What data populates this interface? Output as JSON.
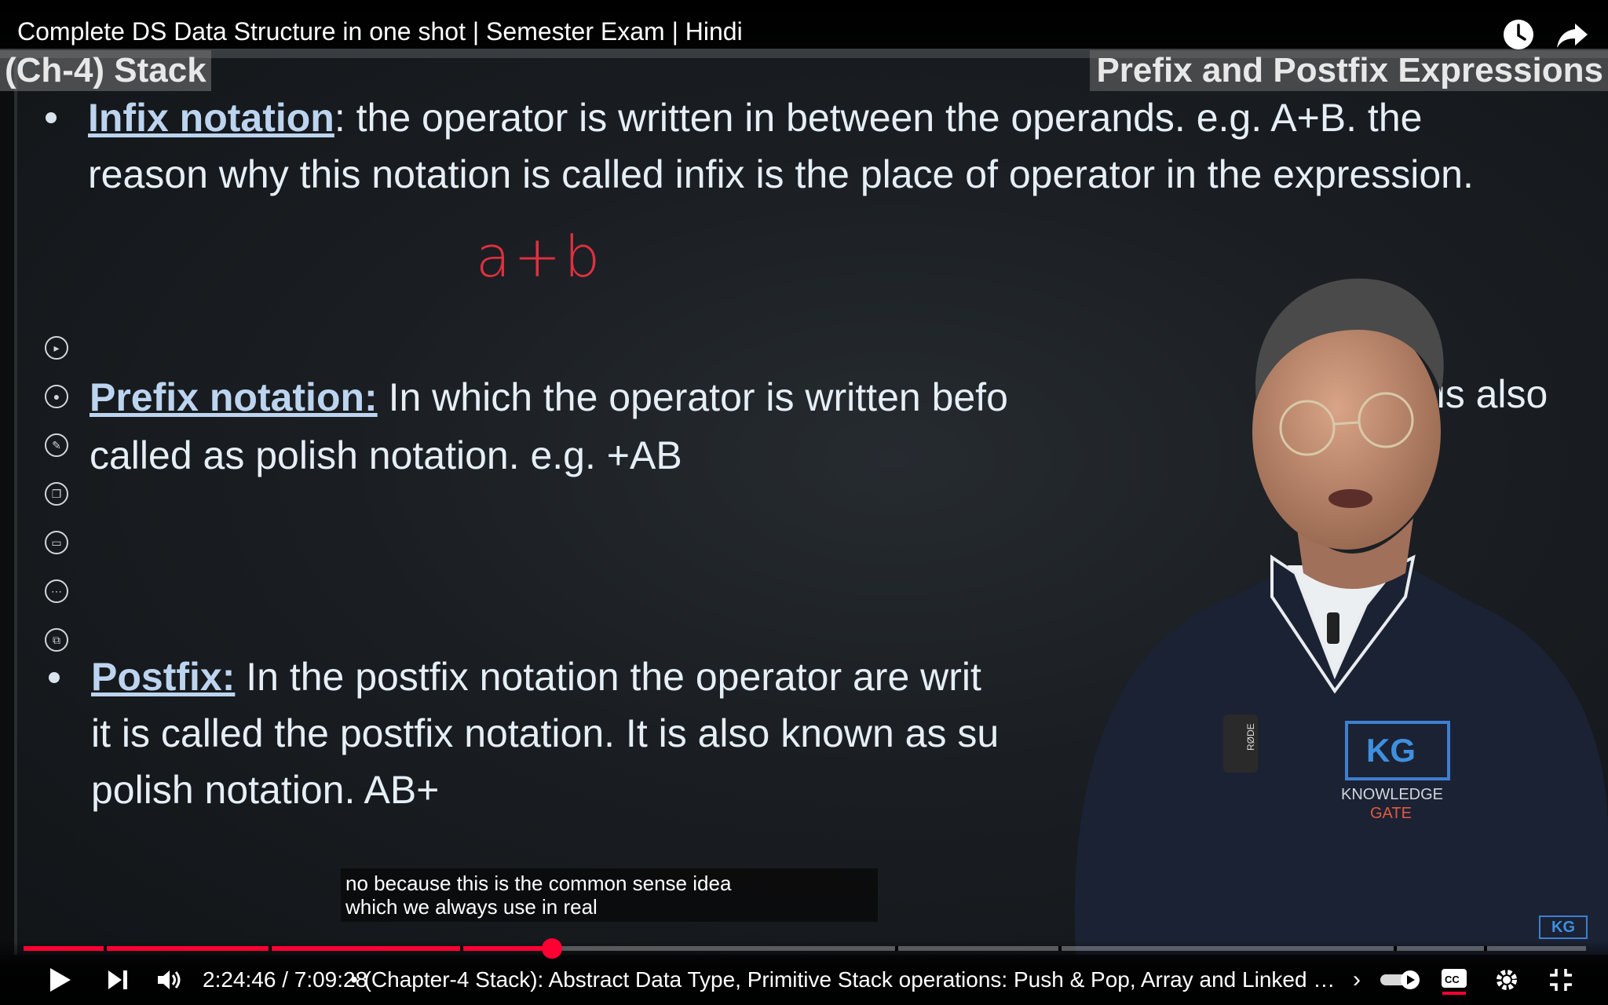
{
  "player": {
    "title": "Complete DS Data Structure in one shot | Semester Exam | Hindi",
    "watch_later_icon": "clock-icon",
    "share_icon": "share-arrow-icon"
  },
  "slide": {
    "chapter_label": "(Ch-4) Stack",
    "topic_label": "Prefix and Postfix Expressions",
    "infix": {
      "term": "Infix notation",
      "line1_rest": ": the operator is written in between the operands. e.g. A+B. the",
      "line2": "reason why this notation is called infix is the place of operator in the expression."
    },
    "handwriting": "a+b",
    "prefix": {
      "term": "Prefix notation:",
      "line1_a": " In which the operator is written befo",
      "line1_b": "ds it is also",
      "line2": "called as polish notation. e.g. +AB"
    },
    "postfix": {
      "term": "Postfix:",
      "line1_rest": " In the postfix notation the operator are writ",
      "line2": "it is called the postfix notation. It is also known as su",
      "line3": "polish notation. AB+"
    },
    "shirt_logo": {
      "top": "KG",
      "name": "KNOWLEDGE",
      "name2": "GATE"
    },
    "mic_brand": "RØDE",
    "corner_logo": "KG"
  },
  "captions": {
    "line1": "no because this is the common sense idea",
    "line2": "which we always use in real"
  },
  "controls": {
    "time": "2:24:46 / 7:09:28",
    "chapter": "• (Chapter-4 Stack): Abstract Data Type, Primitive Stack operations: Push & Pop, Array and Linked Implementati…",
    "progress_fraction": 0.338,
    "accent": "#ff0033"
  }
}
